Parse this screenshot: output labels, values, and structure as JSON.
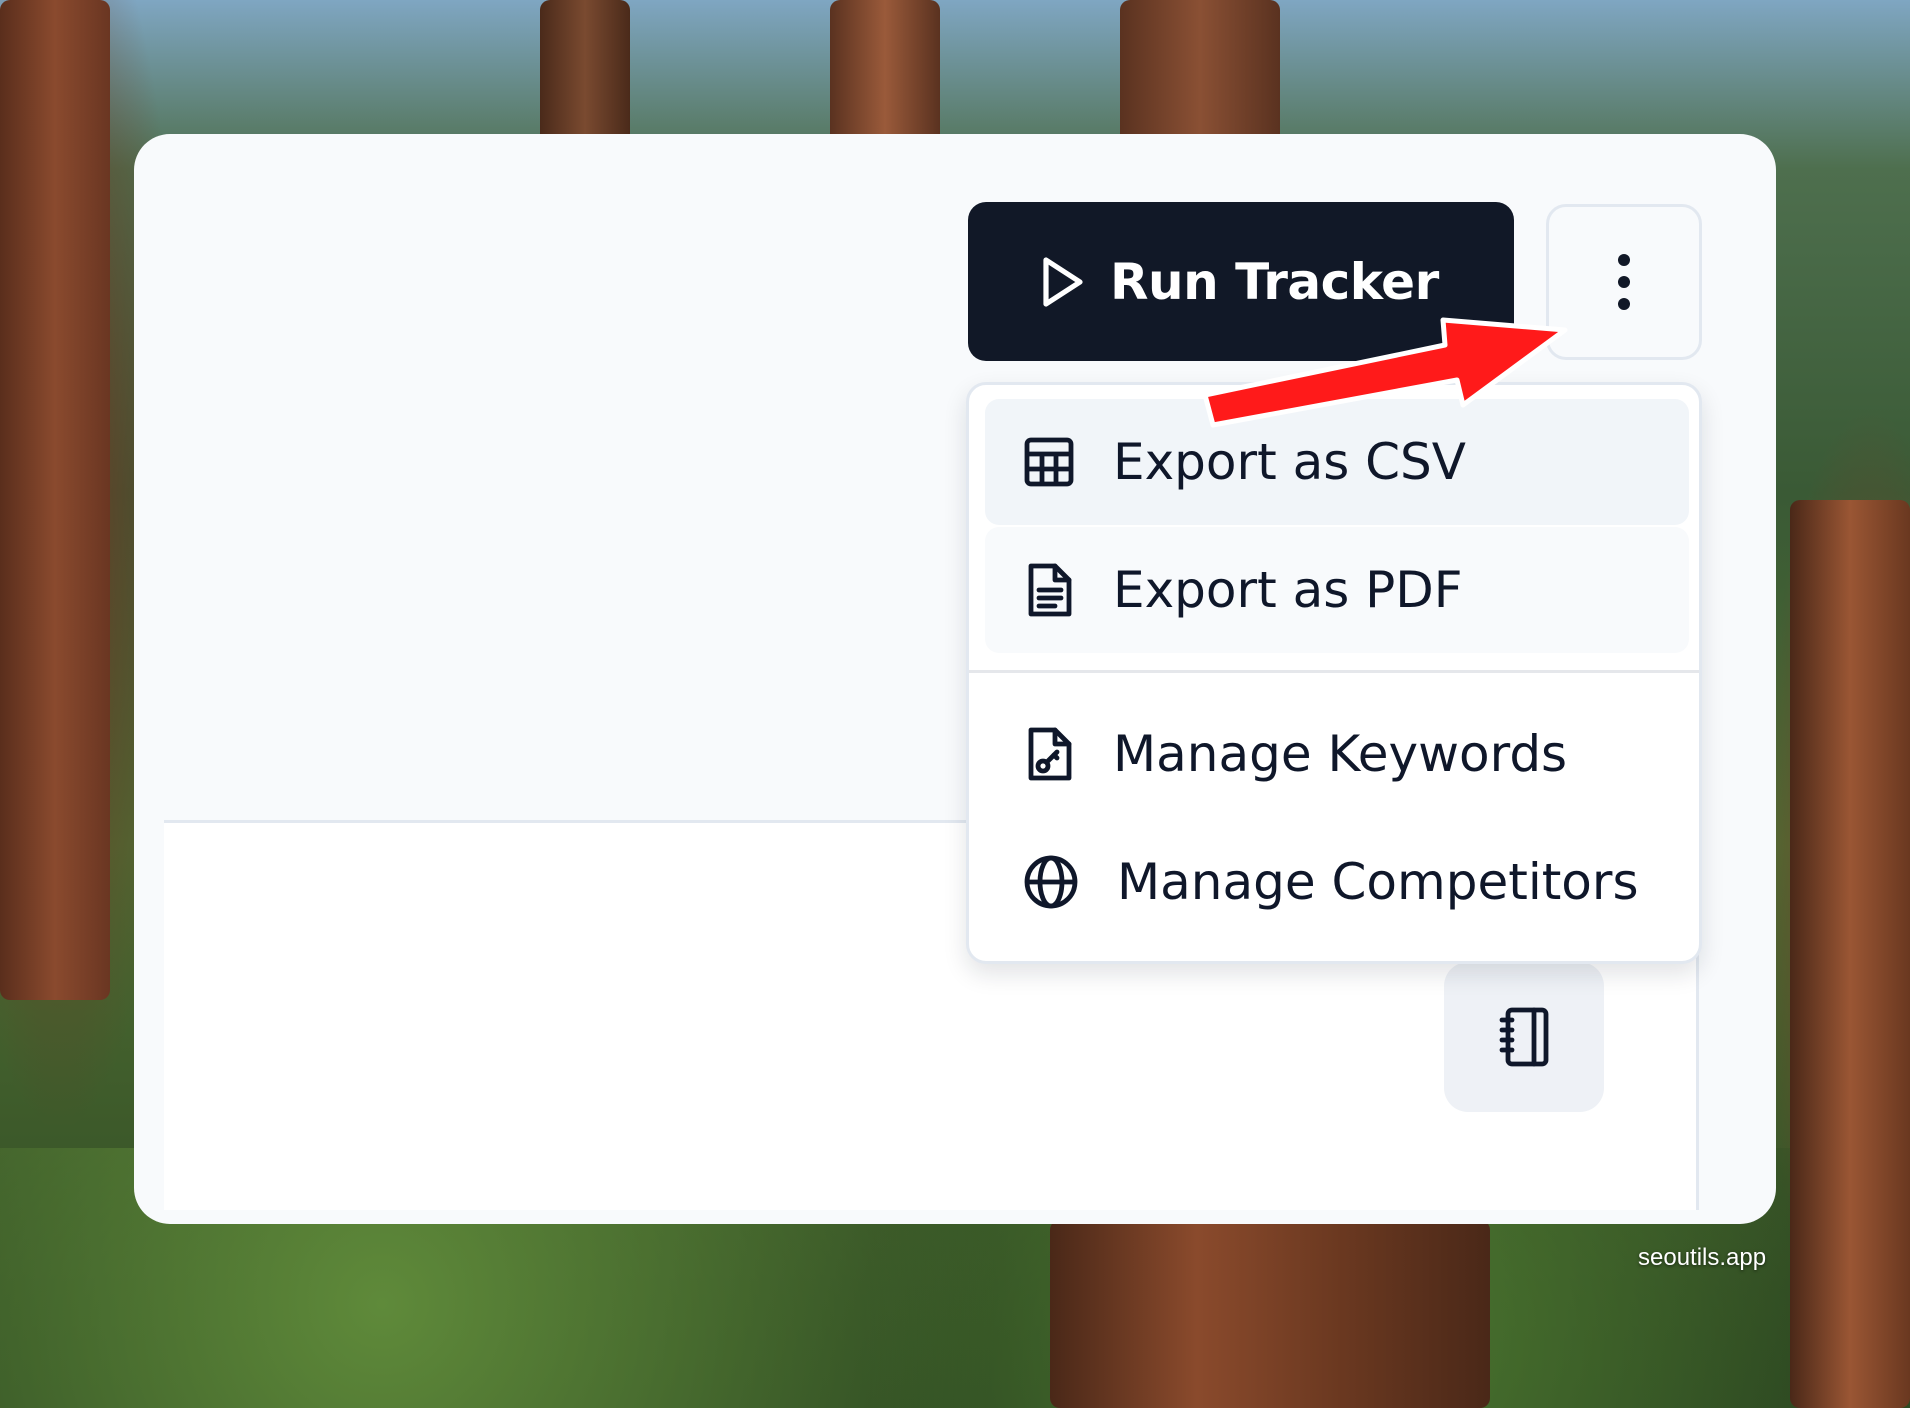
{
  "toolbar": {
    "run_label": "Run Tracker",
    "run_icon": "play-icon",
    "more_icon": "vertical-dots-icon"
  },
  "menu": {
    "items": [
      {
        "label": "Export as CSV",
        "icon": "table-icon"
      },
      {
        "label": "Export as PDF",
        "icon": "document-icon"
      },
      {
        "label": "Manage Keywords",
        "icon": "file-key-icon"
      },
      {
        "label": "Manage Competitors",
        "icon": "globe-icon"
      }
    ]
  },
  "content": {
    "notebook_icon": "notebook-icon"
  },
  "watermark": "seoutils.app",
  "colors": {
    "primary_button": "#111827",
    "annotation_arrow": "#ff1a1a",
    "card_background": "#f8fafc"
  }
}
